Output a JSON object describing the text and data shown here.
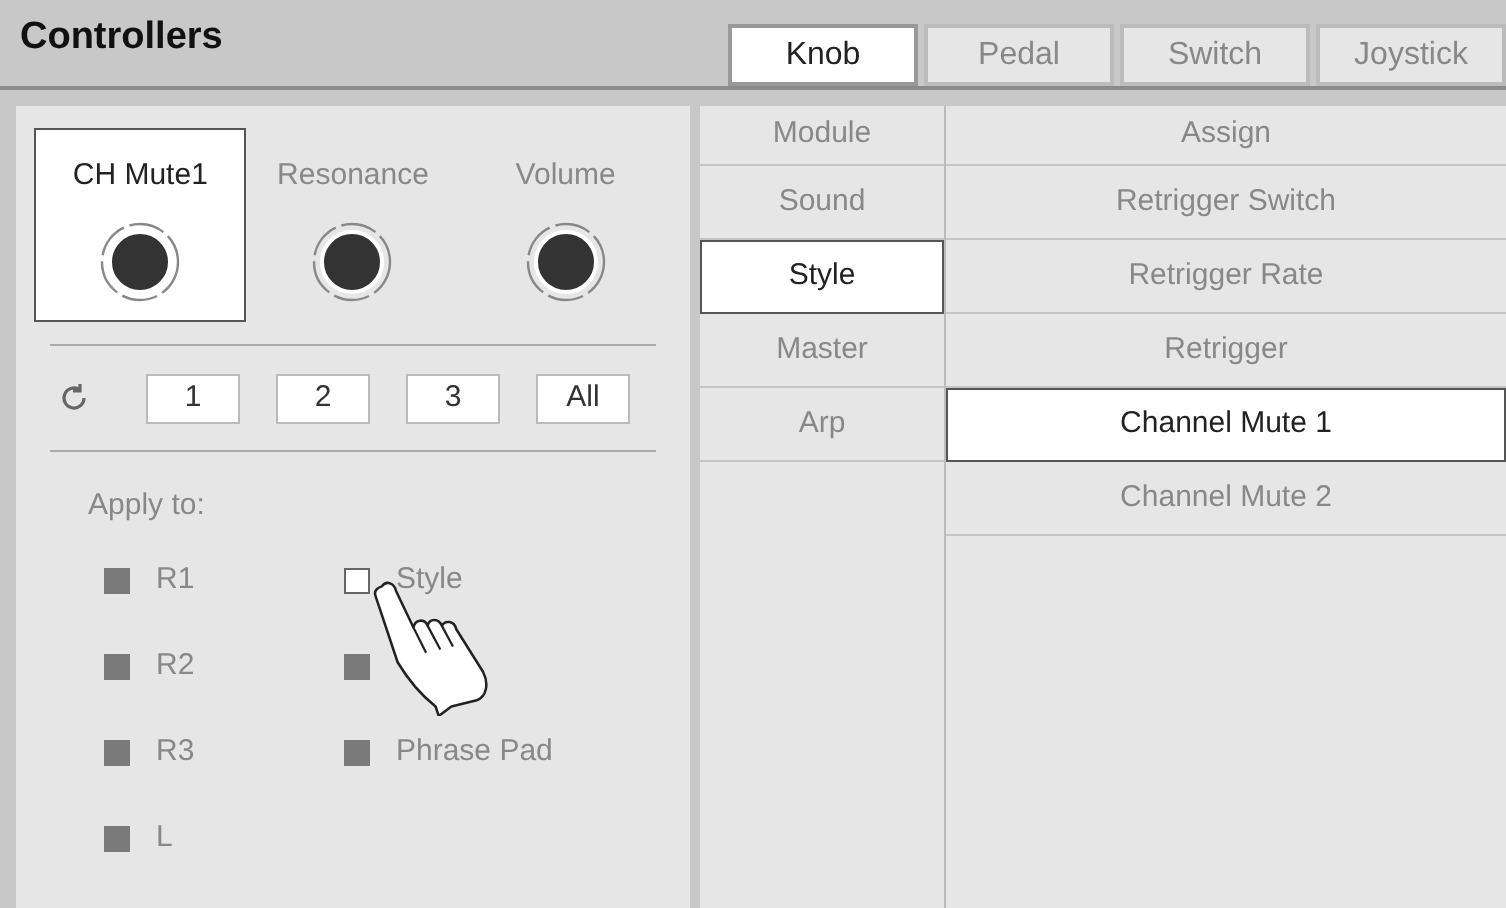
{
  "header": {
    "title": "Controllers"
  },
  "tabs": [
    {
      "label": "Knob",
      "selected": true
    },
    {
      "label": "Pedal",
      "selected": false
    },
    {
      "label": "Switch",
      "selected": false
    },
    {
      "label": "Joystick",
      "selected": false
    }
  ],
  "knobs": [
    {
      "label": "CH Mute1",
      "selected": true
    },
    {
      "label": "Resonance",
      "selected": false
    },
    {
      "label": "Volume",
      "selected": false
    }
  ],
  "presets": [
    "1",
    "2",
    "3",
    "All"
  ],
  "apply_to": {
    "label": "Apply to:",
    "options": [
      {
        "label": "R1",
        "checked": true
      },
      {
        "label": "Style",
        "checked": false
      },
      {
        "label": "R2",
        "checked": true
      },
      {
        "checked": true
      },
      {
        "label": "R3",
        "checked": true
      },
      {
        "label": "Phrase Pad",
        "checked": true
      },
      {
        "label": "L",
        "checked": true
      }
    ]
  },
  "table": {
    "columns": [
      "Module",
      "Assign"
    ],
    "modules": [
      {
        "label": "Sound",
        "selected": false
      },
      {
        "label": "Style",
        "selected": true
      },
      {
        "label": "Master",
        "selected": false
      },
      {
        "label": "Arp",
        "selected": false
      }
    ],
    "assigns": [
      {
        "label": "Retrigger Switch",
        "selected": false
      },
      {
        "label": "Retrigger Rate",
        "selected": false
      },
      {
        "label": "Retrigger",
        "selected": false
      },
      {
        "label": "Channel Mute 1",
        "selected": true
      },
      {
        "label": "Channel Mute 2",
        "selected": false
      }
    ]
  }
}
